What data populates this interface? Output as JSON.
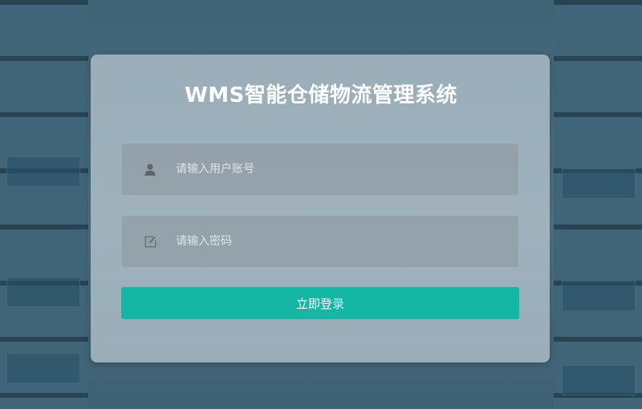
{
  "title": "WMS智能仓储物流管理系统",
  "username": {
    "placeholder": "请输入用户账号",
    "value": "",
    "icon": "user-icon"
  },
  "password": {
    "placeholder": "请输入密码",
    "value": "",
    "icon": "edit-icon"
  },
  "login_button": {
    "label": "立即登录"
  },
  "colors": {
    "button": "#16b6a4",
    "background": "#3d6072",
    "card": "#bccbd3"
  }
}
